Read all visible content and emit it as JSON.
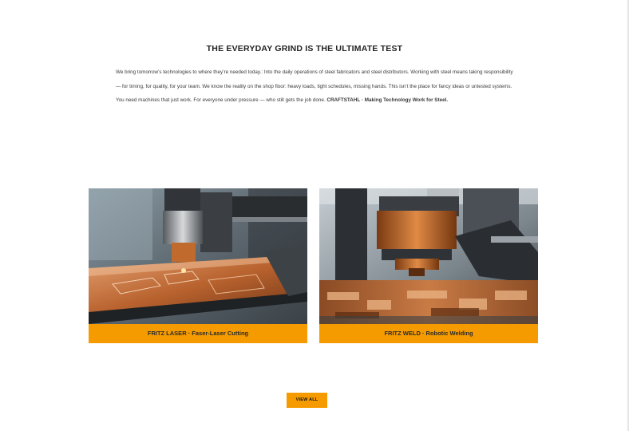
{
  "intro": {
    "title": "THE EVERYDAY GRIND IS THE ULTIMATE TEST",
    "body_text": "We bring tomorrow’s technologies to where they’re needed today.: Into the daily operations of steel fabricators and steel distributors. Working with steel means taking responsibility — for timing, for quality, for your team. We know the reality on the shop floor: heavy loads, tight schedules, missing hands. This isn’t the place for fancy ideas or untested systems. You need machines that just work. For everyone under pressure — who still gets the job done.",
    "body_bold": "CRAFTSTAHL · Making Technology Work for Steel."
  },
  "products": [
    {
      "caption": "FRITZ LASER · Faser-Laser Cutting",
      "image": "laser-cutting-machine-photo"
    },
    {
      "caption": "FRITZ WELD · Robotic Welding",
      "image": "robotic-welding-machine-photo"
    }
  ],
  "view_all_label": "VIEW ALL",
  "colors": {
    "accent": "#f59b00",
    "copper": "#c2692f",
    "text": "#222222"
  }
}
